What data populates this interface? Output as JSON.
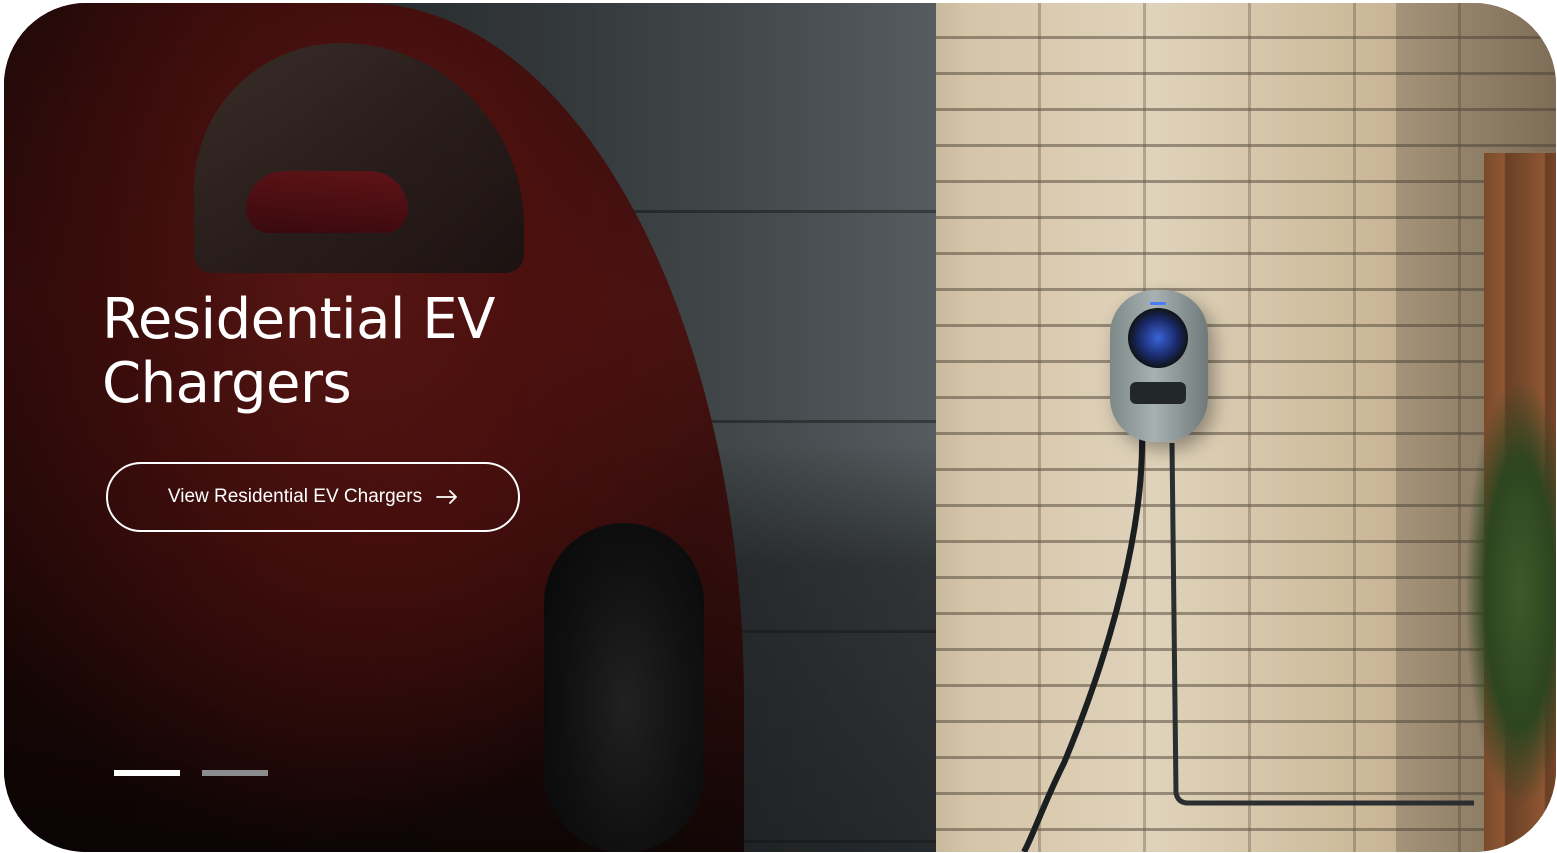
{
  "hero": {
    "headline_line1": "Residential EV",
    "headline_line2": "Chargers",
    "cta_label": "View Residential EV Chargers",
    "cta_icon": "arrow-right-icon",
    "slides": [
      {
        "active": true
      },
      {
        "active": false
      }
    ]
  },
  "colors": {
    "text": "#ffffff",
    "indicator_active": "#ffffff",
    "indicator_inactive": "#8a8c8e",
    "charger_led": "#4a7bff"
  }
}
